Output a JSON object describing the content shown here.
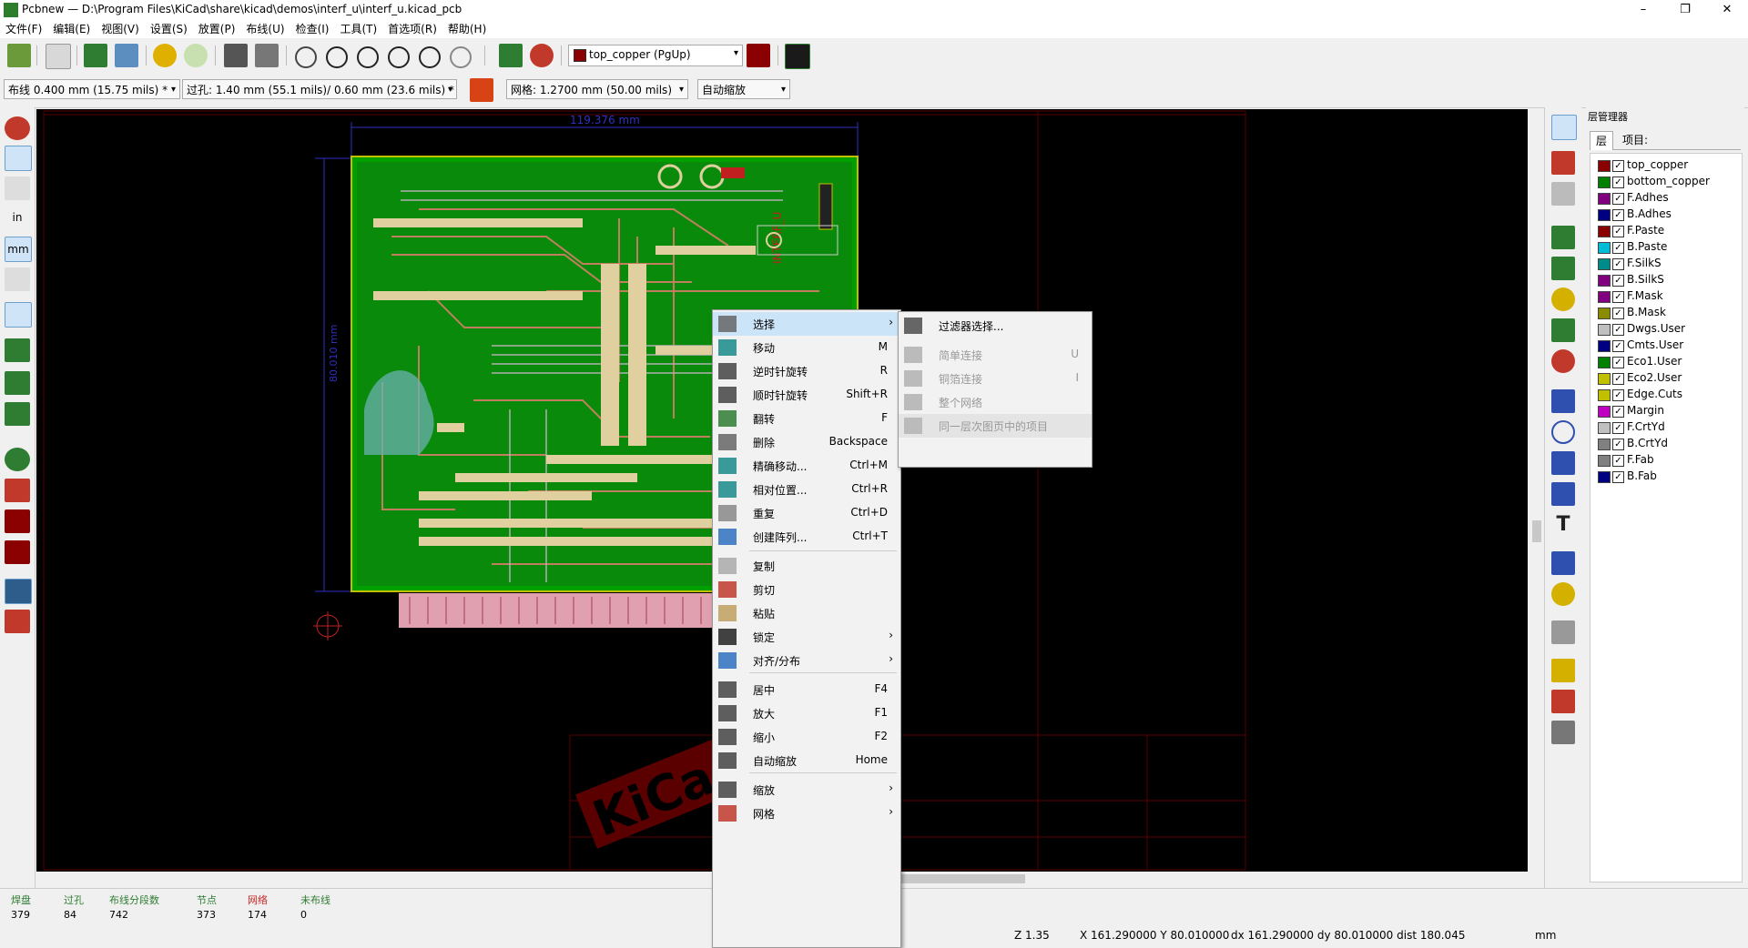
{
  "window": {
    "title": "Pcbnew — D:\\Program Files\\KiCad\\share\\kicad\\demos\\interf_u\\interf_u.kicad_pcb",
    "min": "–",
    "max": "❐",
    "close": "✕"
  },
  "menu": [
    "文件(F)",
    "编辑(E)",
    "视图(V)",
    "设置(S)",
    "放置(P)",
    "布线(U)",
    "检查(I)",
    "工具(T)",
    "首选项(R)",
    "帮助(H)"
  ],
  "toolbar": {
    "layer": "top_copper (PgUp)",
    "track": "布线 0.400 mm (15.75 mils) *",
    "via": "过孔: 1.40 mm (55.1 mils)/ 0.60 mm (23.6 mils) *",
    "grid": "网格: 1.2700 mm (50.00 mils)",
    "zoom": "自动缩放"
  },
  "left_toolbar": {
    "in": "in",
    "mm": "mm"
  },
  "canvas": {
    "dim_h": "119.376 mm",
    "dim_v": "80.010 mm",
    "board_label": "INTERF_U",
    "watermark": "KiCad"
  },
  "layers_panel": {
    "title": "层管理器",
    "tab_layers": "层",
    "tab_items": "项目:",
    "layers": [
      {
        "name": "top_copper",
        "color": "#8b0000"
      },
      {
        "name": "bottom_copper",
        "color": "#008000"
      },
      {
        "name": "F.Adhes",
        "color": "#800080"
      },
      {
        "name": "B.Adhes",
        "color": "#000080"
      },
      {
        "name": "F.Paste",
        "color": "#8b0000"
      },
      {
        "name": "B.Paste",
        "color": "#00bcd4"
      },
      {
        "name": "F.SilkS",
        "color": "#008b8b"
      },
      {
        "name": "B.SilkS",
        "color": "#800080"
      },
      {
        "name": "F.Mask",
        "color": "#800080"
      },
      {
        "name": "B.Mask",
        "color": "#8b8b00"
      },
      {
        "name": "Dwgs.User",
        "color": "#c0c0c0"
      },
      {
        "name": "Cmts.User",
        "color": "#000080"
      },
      {
        "name": "Eco1.User",
        "color": "#008000"
      },
      {
        "name": "Eco2.User",
        "color": "#c0c000"
      },
      {
        "name": "Edge.Cuts",
        "color": "#c0c000"
      },
      {
        "name": "Margin",
        "color": "#c000c0"
      },
      {
        "name": "F.CrtYd",
        "color": "#c0c0c0"
      },
      {
        "name": "B.CrtYd",
        "color": "#808080"
      },
      {
        "name": "F.Fab",
        "color": "#808080"
      },
      {
        "name": "B.Fab",
        "color": "#000080"
      }
    ]
  },
  "status": {
    "pads_label": "焊盘",
    "pads": "379",
    "vias_label": "过孔",
    "vias": "84",
    "segments_label": "布线分段数",
    "segments": "742",
    "nodes_label": "节点",
    "nodes": "373",
    "nets_label": "网络",
    "nets": "174",
    "unrouted_label": "未布线",
    "unrouted": "0",
    "zoom": "Z 1.35",
    "xy": "X 161.290000  Y 80.010000",
    "dxy": "dx 161.290000  dy 80.010000  dist 180.045",
    "units": "mm"
  },
  "context_menu": [
    {
      "label": "选择",
      "shortcut": "",
      "submenu": true
    },
    {
      "label": "移动",
      "shortcut": "M"
    },
    {
      "label": "逆时针旋转",
      "shortcut": "R"
    },
    {
      "label": "顺时针旋转",
      "shortcut": "Shift+R"
    },
    {
      "label": "翻转",
      "shortcut": "F"
    },
    {
      "label": "删除",
      "shortcut": "Backspace"
    },
    {
      "label": "精确移动...",
      "shortcut": "Ctrl+M"
    },
    {
      "label": "相对位置...",
      "shortcut": "Ctrl+R"
    },
    {
      "label": "重复",
      "shortcut": "Ctrl+D"
    },
    {
      "label": "创建阵列...",
      "shortcut": "Ctrl+T"
    },
    {
      "label": "复制",
      "shortcut": ""
    },
    {
      "label": "剪切",
      "shortcut": ""
    },
    {
      "label": "粘贴",
      "shortcut": ""
    },
    {
      "label": "锁定",
      "shortcut": "",
      "submenu": true
    },
    {
      "label": "对齐/分布",
      "shortcut": "",
      "submenu": true
    },
    {
      "label": "居中",
      "shortcut": "F4"
    },
    {
      "label": "放大",
      "shortcut": "F1"
    },
    {
      "label": "缩小",
      "shortcut": "F2"
    },
    {
      "label": "自动缩放",
      "shortcut": "Home"
    },
    {
      "label": "缩放",
      "shortcut": "",
      "submenu": true
    },
    {
      "label": "网格",
      "shortcut": "",
      "submenu": true
    }
  ],
  "select_submenu": [
    {
      "label": "过滤器选择...",
      "shortcut": "",
      "enabled": true
    },
    {
      "label": "简单连接",
      "shortcut": "U",
      "enabled": false
    },
    {
      "label": "铜箔连接",
      "shortcut": "I",
      "enabled": false
    },
    {
      "label": "整个网络",
      "shortcut": "",
      "enabled": false
    },
    {
      "label": "同一层次图页中的项目",
      "shortcut": "",
      "enabled": false
    }
  ]
}
